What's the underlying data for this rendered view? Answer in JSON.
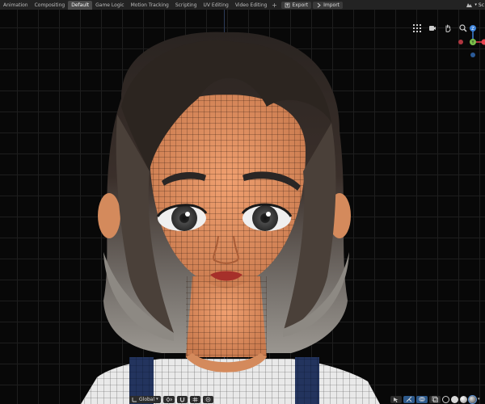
{
  "workspace_tabs": [
    {
      "label": "Animation",
      "active": false
    },
    {
      "label": "Compositing",
      "active": false
    },
    {
      "label": "Default",
      "active": true
    },
    {
      "label": "Game Logic",
      "active": false
    },
    {
      "label": "Motion Tracking",
      "active": false
    },
    {
      "label": "Scripting",
      "active": false
    },
    {
      "label": "UV Editing",
      "active": false
    },
    {
      "label": "Video Editing",
      "active": false
    }
  ],
  "add_tab_label": "+",
  "menu": {
    "export_label": "Export",
    "import_label": "Import"
  },
  "scene_label": "Sc",
  "viewport": {
    "nav_icons": [
      "grid-icon",
      "camera-icon",
      "hand-pan-icon",
      "zoom-icon"
    ],
    "gizmo": {
      "z_label": "Z",
      "y_label": "Y",
      "colors": {
        "x": "#e8434f",
        "y": "#7bc04a",
        "z": "#3d83d9"
      }
    }
  },
  "bottom_bar": {
    "orientation_label": "Global"
  },
  "colors": {
    "topbar": "#232323",
    "active_tab": "#4a4a4a",
    "viewport_bg": "#080808",
    "grid": "#1e1e1e"
  }
}
